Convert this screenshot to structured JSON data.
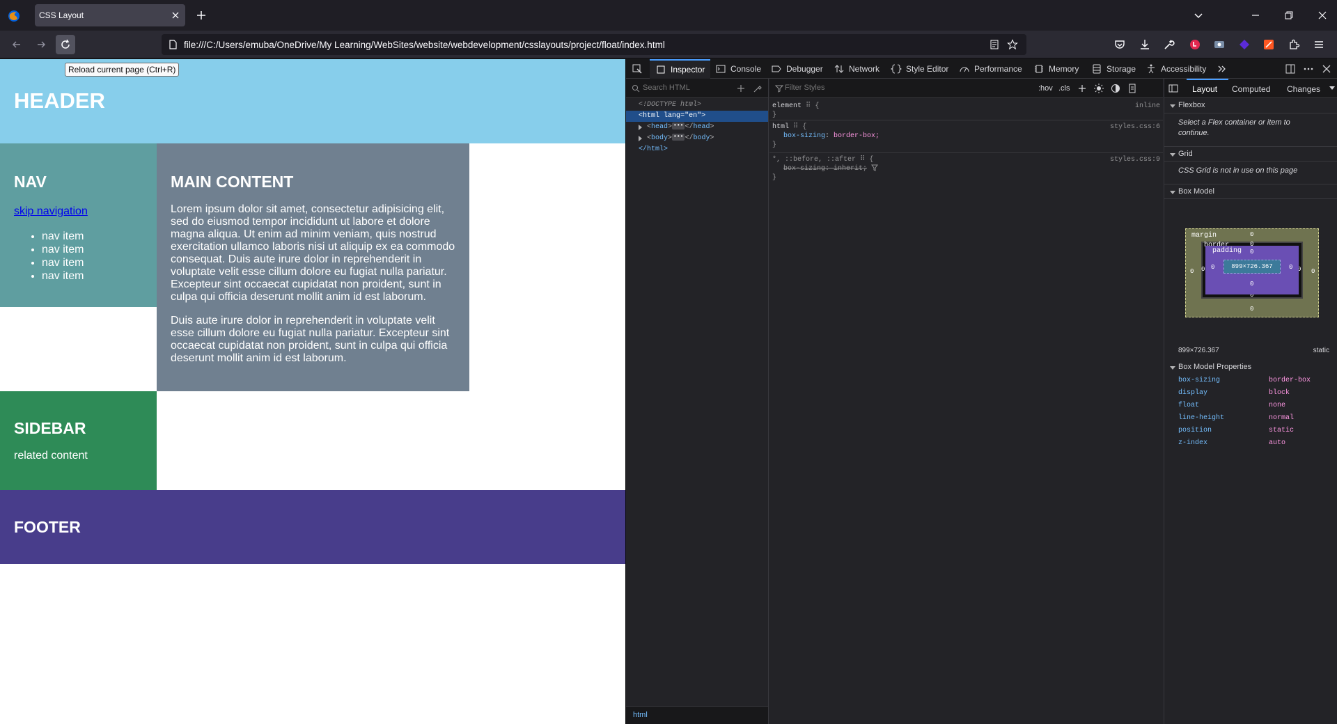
{
  "browser": {
    "tab_title": "CSS Layout",
    "url": "file:///C:/Users/emuba/OneDrive/My Learning/WebSites/website/webdevelopment/csslayouts/project/float/index.html",
    "tooltip": "Reload current page (Ctrl+R)"
  },
  "page": {
    "header": "HEADER",
    "nav": {
      "title": "NAV",
      "skip_link": "skip navigation",
      "items": [
        "nav item",
        "nav item",
        "nav item",
        "nav item"
      ]
    },
    "main": {
      "title": "MAIN CONTENT",
      "p1": "Lorem ipsum dolor sit amet, consectetur adipisicing elit, sed do eiusmod tempor incididunt ut labore et dolore magna aliqua. Ut enim ad minim veniam, quis nostrud exercitation ullamco laboris nisi ut aliquip ex ea commodo consequat. Duis aute irure dolor in reprehenderit in voluptate velit esse cillum dolore eu fugiat nulla pariatur. Excepteur sint occaecat cupidatat non proident, sunt in culpa qui officia deserunt mollit anim id est laborum.",
      "p2": "Duis aute irure dolor in reprehenderit in voluptate velit esse cillum dolore eu fugiat nulla pariatur. Excepteur sint occaecat cupidatat non proident, sunt in culpa qui officia deserunt mollit anim id est laborum."
    },
    "sidebar": {
      "title": "SIDEBAR",
      "text": "related content"
    },
    "footer": "FOOTER",
    "colors": {
      "header": "#87ceeb",
      "nav": "#5f9ea0",
      "main": "#708090",
      "sidebar": "#2e8b57",
      "footer": "#483d8b"
    }
  },
  "devtools": {
    "tabs": [
      "Inspector",
      "Console",
      "Debugger",
      "Network",
      "Style Editor",
      "Performance",
      "Memory",
      "Storage",
      "Accessibility"
    ],
    "markup": {
      "search_placeholder": "Search HTML",
      "doctype": "<!DOCTYPE html>",
      "html_open_tag": "html",
      "html_attr": "lang",
      "html_attr_val": "\"en\"",
      "head": "head",
      "body": "body",
      "html_close": "</html>",
      "breadcrumb": "html"
    },
    "rules": {
      "filter_placeholder": "Filter Styles",
      "hov": ":hov",
      "cls": ".cls",
      "rule1_selector": "element",
      "rule1_source": "inline",
      "rule2_selector": "html",
      "rule2_source": "styles.css:6",
      "rule2_prop": "box-sizing",
      "rule2_val": "border-box;",
      "rule3_selector": "*, ::before, ::after",
      "rule3_source": "styles.css:9",
      "rule3_prop": "box-sizing: inherit;"
    },
    "layout": {
      "tabs": [
        "Layout",
        "Computed",
        "Changes"
      ],
      "flexbox_title": "Flexbox",
      "flexbox_note": "Select a Flex container or item to continue.",
      "grid_title": "Grid",
      "grid_note": "CSS Grid is not in use on this page",
      "box_model_title": "Box Model",
      "bm_labels": {
        "margin": "margin",
        "border": "border",
        "padding": "padding"
      },
      "bm_zero": "0",
      "content_size": "899×726.367",
      "dimensions": "899×726.367",
      "position": "static",
      "props_title": "Box Model Properties",
      "props": [
        {
          "k": "box-sizing",
          "v": "border-box"
        },
        {
          "k": "display",
          "v": "block"
        },
        {
          "k": "float",
          "v": "none"
        },
        {
          "k": "line-height",
          "v": "normal"
        },
        {
          "k": "position",
          "v": "static"
        },
        {
          "k": "z-index",
          "v": "auto"
        }
      ]
    }
  }
}
